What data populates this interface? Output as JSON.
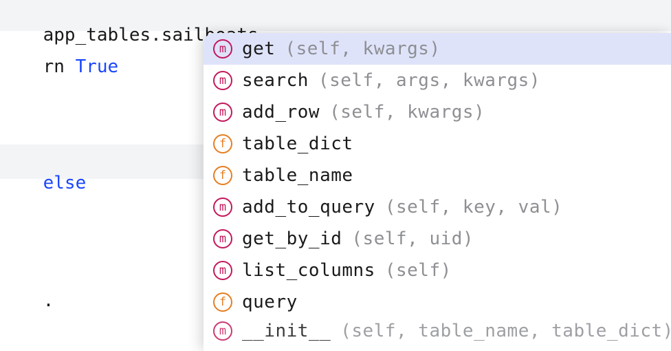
{
  "code": {
    "line1_a": "app_tables",
    "line1_b": ".",
    "line1_c": "sailboats",
    "line1_d": ".",
    "line2_a": "rn ",
    "line2_b": "True",
    "line3": "else",
    "dot_text": "."
  },
  "autocomplete": {
    "items": [
      {
        "kind": "m",
        "name": "get",
        "params": "(self, kwargs)",
        "selected": true
      },
      {
        "kind": "m",
        "name": "search",
        "params": "(self, args, kwargs)",
        "selected": false
      },
      {
        "kind": "m",
        "name": "add_row",
        "params": "(self, kwargs)",
        "selected": false
      },
      {
        "kind": "f",
        "name": "table_dict",
        "params": "",
        "selected": false
      },
      {
        "kind": "f",
        "name": "table_name",
        "params": "",
        "selected": false
      },
      {
        "kind": "m",
        "name": "add_to_query",
        "params": "(self, key, val)",
        "selected": false
      },
      {
        "kind": "m",
        "name": "get_by_id",
        "params": "(self, uid)",
        "selected": false
      },
      {
        "kind": "m",
        "name": "list_columns",
        "params": "(self)",
        "selected": false
      },
      {
        "kind": "f",
        "name": "query",
        "params": "",
        "selected": false
      },
      {
        "kind": "m",
        "name": "__init__",
        "params": "(self, table_name, table_dict)",
        "selected": false
      }
    ]
  },
  "icon_glyph": {
    "m": "m",
    "f": "f"
  }
}
